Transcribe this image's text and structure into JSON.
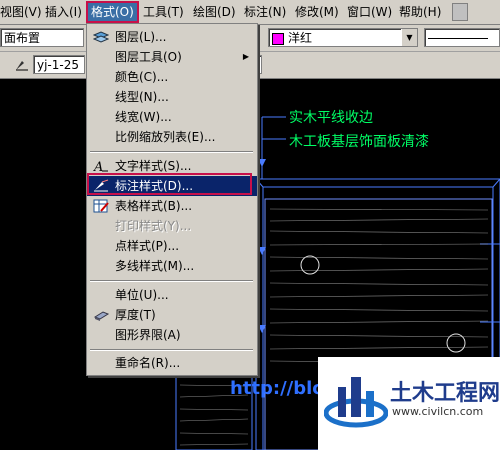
{
  "menubar": {
    "items": [
      {
        "label": "视图(V)"
      },
      {
        "label": "插入(I)"
      },
      {
        "label": "格式(O)"
      },
      {
        "label": "工具(T)"
      },
      {
        "label": "绘图(D)"
      },
      {
        "label": "标注(N)"
      },
      {
        "label": "修改(M)"
      },
      {
        "label": "窗口(W)"
      },
      {
        "label": "帮助(H)"
      }
    ]
  },
  "toolbar1": {
    "layout_combo": "面布置",
    "color_combo": "洋红",
    "color_swatch": "#ff00ff"
  },
  "toolbar2": {
    "dimstyle_combo": "yj-1-25"
  },
  "format_menu": {
    "items": [
      {
        "label": "图层(L)...",
        "icon": "layers-icon"
      },
      {
        "label": "图层工具(O)",
        "submenu": true
      },
      {
        "label": "颜色(C)..."
      },
      {
        "label": "线型(N)..."
      },
      {
        "label": "线宽(W)..."
      },
      {
        "label": "比例缩放列表(E)..."
      },
      {
        "label": "文字样式(S)...",
        "icon": "text-style-icon"
      },
      {
        "label": "标注样式(D)...",
        "icon": "dim-style-icon"
      },
      {
        "label": "表格样式(B)...",
        "icon": "table-style-icon"
      },
      {
        "label": "打印样式(Y)...",
        "disabled": true
      },
      {
        "label": "点样式(P)..."
      },
      {
        "label": "多线样式(M)..."
      },
      {
        "label": "单位(U)..."
      },
      {
        "label": "厚度(T)",
        "icon": "thickness-icon"
      },
      {
        "label": "图形界限(A)"
      },
      {
        "label": "重命名(R)..."
      }
    ]
  },
  "canvas": {
    "note1": "实木平线收边",
    "note2": "木工板基层饰面板清漆",
    "url_text": "http://blo"
  },
  "logo": {
    "name": "土木工程网",
    "url": "www.civilcn.com"
  },
  "colors": {
    "highlight_border": "#c8104a",
    "cad_text": "#00ff66",
    "cad_lines": "#4a7cff"
  }
}
